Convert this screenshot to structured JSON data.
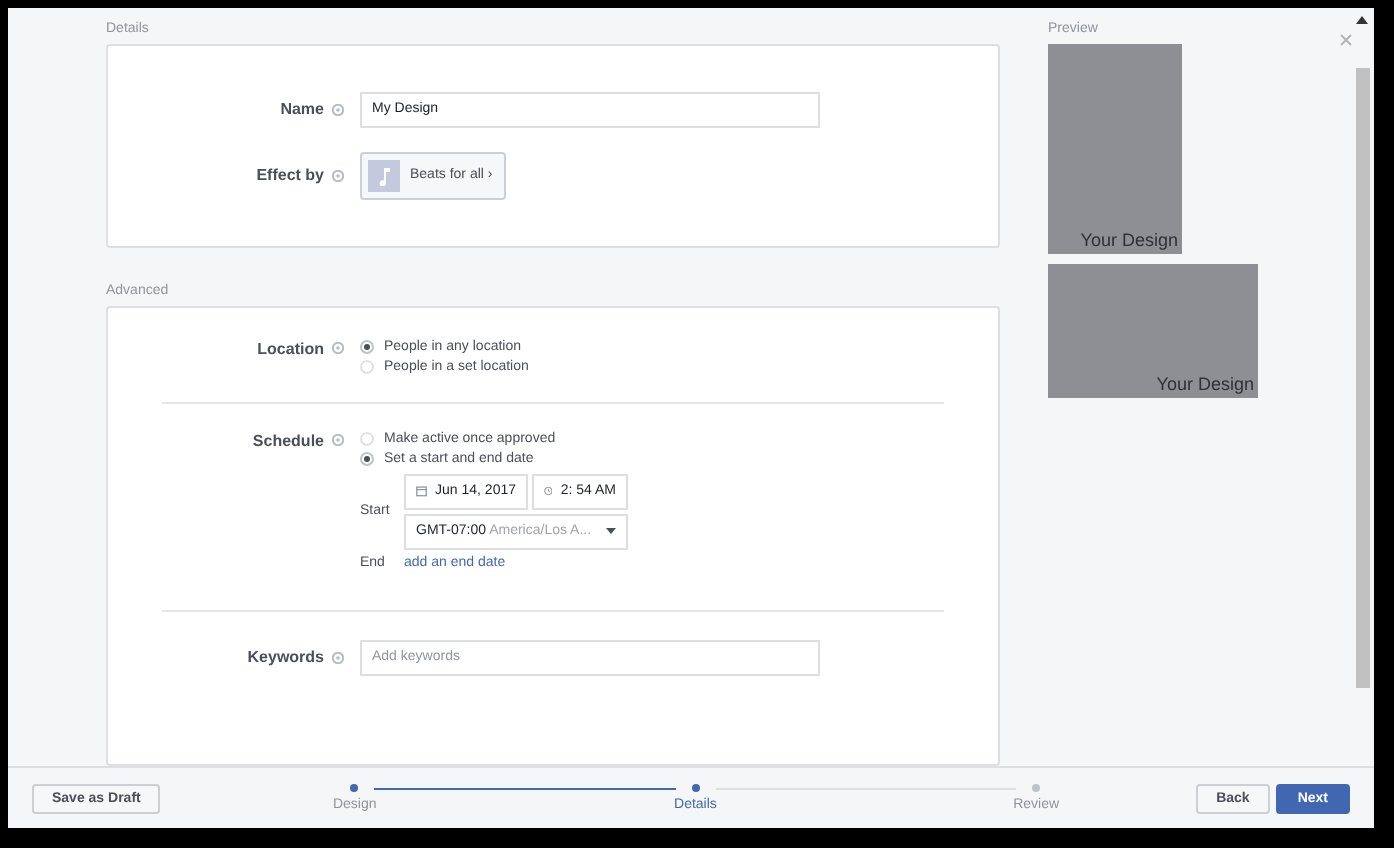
{
  "details": {
    "title": "Details",
    "name": {
      "label": "Name",
      "value": "My Design"
    },
    "effect": {
      "label": "Effect by",
      "value": "Beats for all ›"
    }
  },
  "advanced": {
    "title": "Advanced",
    "location": {
      "label": "Location",
      "options": [
        {
          "label": "People in any location",
          "selected": true
        },
        {
          "label": "People in a set location",
          "selected": false
        }
      ]
    },
    "schedule": {
      "label": "Schedule",
      "options": [
        {
          "label": "Make active once approved",
          "selected": false
        },
        {
          "label": "Set a start and end date",
          "selected": true
        }
      ],
      "start_label": "Start",
      "date": "Jun 14, 2017",
      "time": "2: 54 AM",
      "timezone_offset": "GMT-07:00",
      "timezone_name": "America/Los A...",
      "end_label": "End",
      "end_link": "add an end date"
    },
    "keywords": {
      "label": "Keywords",
      "placeholder": "Add keywords"
    }
  },
  "preview": {
    "title": "Preview",
    "items": [
      {
        "kind": "portrait",
        "caption": "Your Design"
      },
      {
        "kind": "landscape",
        "caption": "Your Design"
      }
    ]
  },
  "footer": {
    "save_draft": "Save as Draft",
    "steps": [
      {
        "label": "Design",
        "selected": false,
        "reached": true
      },
      {
        "label": "Details",
        "selected": true,
        "reached": true
      },
      {
        "label": "Review",
        "selected": false,
        "reached": false
      }
    ],
    "back": "Back",
    "next": "Next"
  }
}
